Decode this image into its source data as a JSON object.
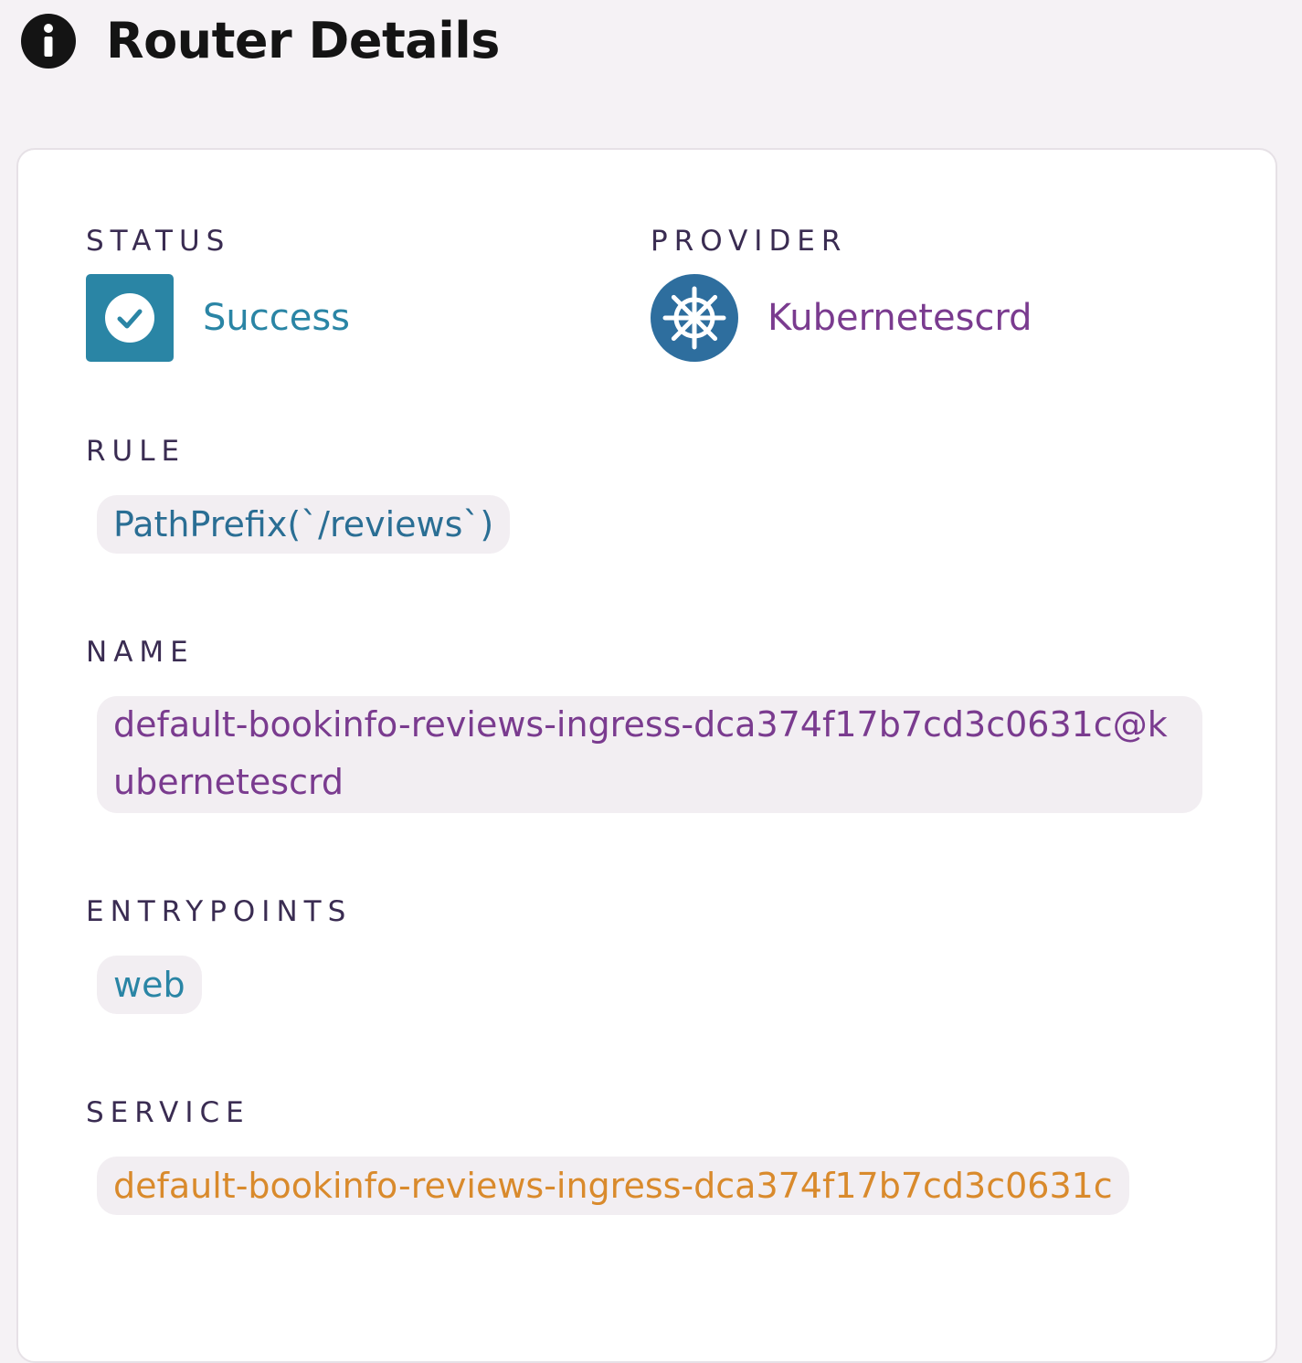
{
  "header": {
    "title": "Router Details",
    "icon": "info-icon"
  },
  "status": {
    "label": "STATUS",
    "value": "Success",
    "icon": "check-circle-icon",
    "color": "#2a85a5"
  },
  "provider": {
    "label": "PROVIDER",
    "value": "Kubernetescrd",
    "icon": "kubernetes-icon",
    "color": "#7a3b8f"
  },
  "rule": {
    "label": "RULE",
    "value": "PathPrefix(`/reviews`)"
  },
  "name": {
    "label": "NAME",
    "value": "default-bookinfo-reviews-ingress-dca374f17b7cd3c0631c@kubernetescrd"
  },
  "entrypoints": {
    "label": "ENTRYPOINTS",
    "items": [
      "web"
    ]
  },
  "service": {
    "label": "SERVICE",
    "value": "default-bookinfo-reviews-ingress-dca374f17b7cd3c0631c",
    "color": "#d98a2c"
  }
}
